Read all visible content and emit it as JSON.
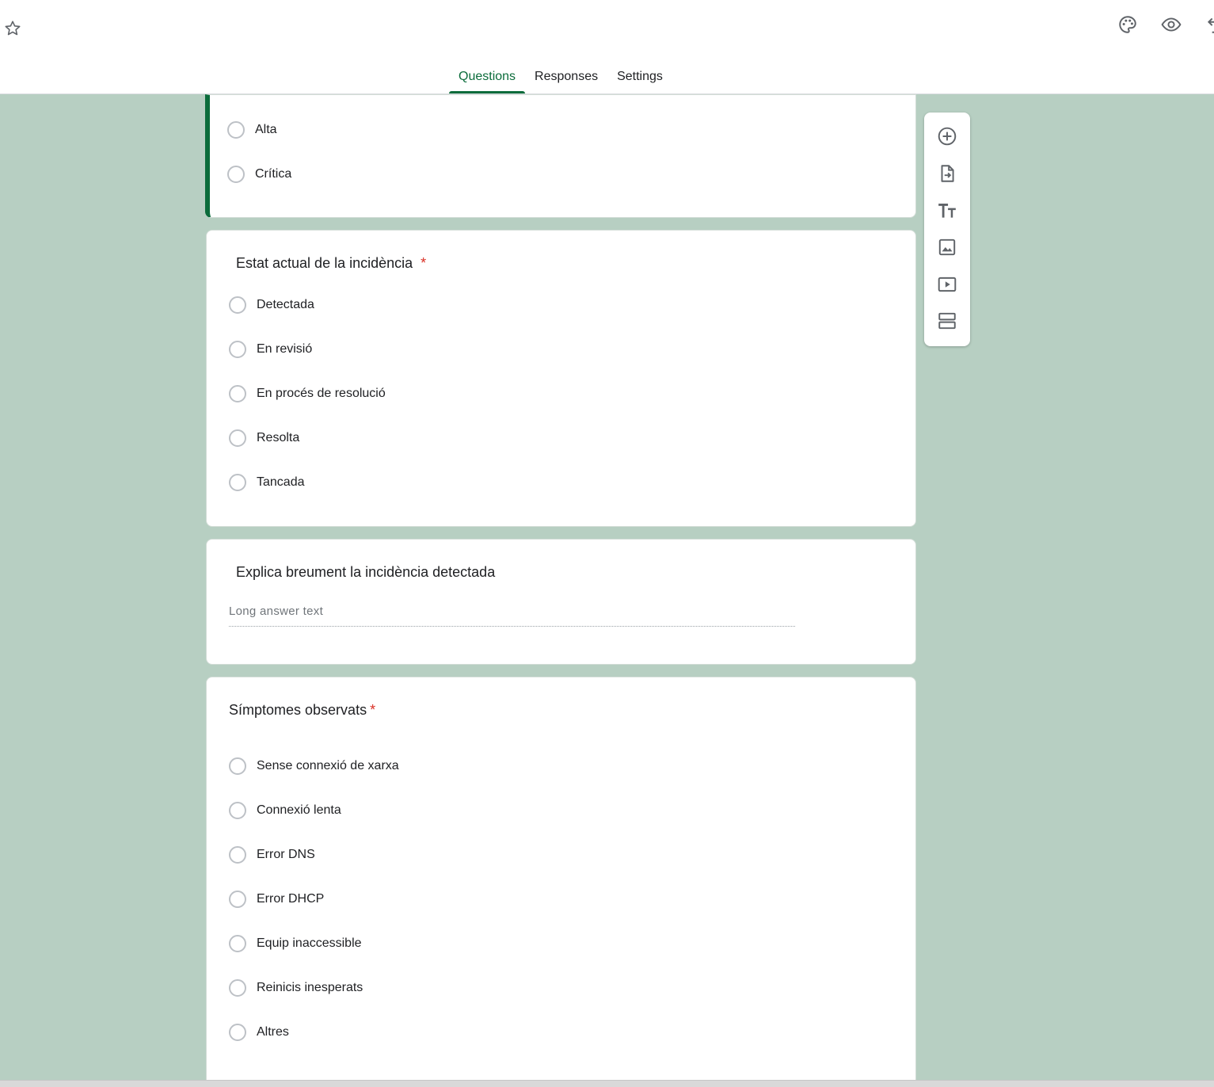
{
  "header": {
    "star_icon": "star-outline-icon",
    "right_icons": [
      "palette-icon",
      "eye-icon",
      "undo-icon"
    ]
  },
  "tabs": [
    {
      "label": "Questions",
      "active": true
    },
    {
      "label": "Responses",
      "active": false
    },
    {
      "label": "Settings",
      "active": false
    }
  ],
  "questions": {
    "q_priority": {
      "options": [
        "Alta",
        "Crítica"
      ]
    },
    "q_status": {
      "title": "Estat actual de la incidència",
      "required_mark": "*",
      "options": [
        "Detectada",
        "En revisió",
        "En procés de resolució",
        "Resolta",
        "Tancada"
      ]
    },
    "q_description": {
      "title": "Explica breument la incidència detectada",
      "placeholder": "Long answer text"
    },
    "q_symptoms": {
      "title": "Símptomes observats",
      "required_mark": "*",
      "options": [
        "Sense connexió de xarxa",
        "Connexió lenta",
        "Error DNS",
        "Error DHCP",
        "Equip inaccessible",
        "Reinicis inesperats",
        "Altres"
      ]
    }
  },
  "toolbar": {
    "icons": [
      "add-question-icon",
      "import-questions-icon",
      "add-title-icon",
      "add-image-icon",
      "add-video-icon",
      "add-section-icon"
    ]
  },
  "colors": {
    "accent": "#0b6c3b",
    "background": "#b7cfc2",
    "required": "#d93025"
  }
}
